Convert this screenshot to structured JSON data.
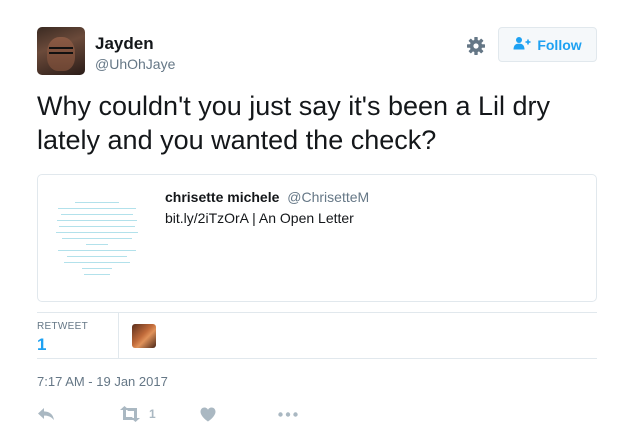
{
  "author": {
    "name": "Jayden",
    "handle": "@UhOhJaye"
  },
  "header": {
    "follow_label": "Follow",
    "settings_icon": "gear-icon",
    "follow_icon": "add-user-icon"
  },
  "tweet": {
    "text": "Why couldn't you just say it's been a Lil dry lately and you wanted the check?"
  },
  "card": {
    "author_name": "chrisette michele",
    "author_handle": "@ChrisetteM",
    "link_text": "bit.ly/2iTzOrA | An Open Letter"
  },
  "stats": {
    "retweet_label": "RETWEET",
    "retweet_count": "1"
  },
  "timestamp": "7:17 AM - 19 Jan 2017",
  "actions": {
    "reply_icon": "reply-icon",
    "retweet_icon": "retweet-icon",
    "retweet_count": "1",
    "like_icon": "heart-icon",
    "more_icon": "more-icon"
  },
  "colors": {
    "accent": "#1da1f2",
    "text": "#14171a",
    "muted": "#657786",
    "border": "#e1e8ed",
    "icon": "#aab8c2"
  }
}
